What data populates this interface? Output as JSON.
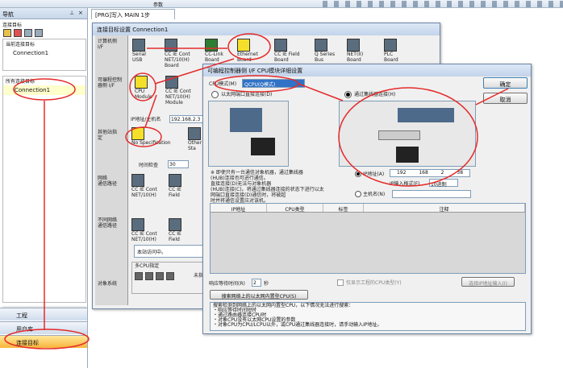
{
  "topbar": {
    "project_label": "参数"
  },
  "nav": {
    "title": "导航",
    "section_label": "连接目标",
    "current_label": "当前连接目标",
    "current_item": "Connection1",
    "all_label": "所有连接目标",
    "all_item": "Connection1",
    "buttons": [
      "工程",
      "用户库",
      "连接目标"
    ]
  },
  "tab": {
    "label": "[PRG]写入 MAIN 1步"
  },
  "conn": {
    "title": "连接目标设置 Connection1",
    "side": {
      "pc_if": "计算机侧\nI/F",
      "plc_if": "可编程控制\n器侧 I/F",
      "other_station": "其他站指\n定",
      "net_route": "网络\n通信路径",
      "diff_net": "不同网络\n通信路径",
      "target_system": "对象系统"
    },
    "pc_if_items": [
      "Serial\nUSB",
      "CC IE Cont\nNET/10(H)\nBoard",
      "CC-Link\nBoard",
      "Ethernet\nBoard",
      "CC IE Field\nBoard",
      "Q Series\nBus",
      "NET(II)\nBoard",
      "PLC\nBoard"
    ],
    "plc_if_items": [
      "CPU\nModule",
      "CC IE Cont\nNET/10(H)\nModule"
    ],
    "ip_label": "IP地址/主机名",
    "ip_value": "192.168.2.3",
    "other_items": [
      "No Specification",
      "Other\nSta"
    ],
    "timeout_label": "时间检查",
    "timeout_value": "30",
    "net_items": [
      "CC IE Cont\nNET/10(H)",
      "CC IE\nField"
    ],
    "diff_items": [
      "CC IE Cont\nNET/10(H)",
      "CC IE\nField"
    ],
    "diff_status": "未指定",
    "remark": "本站访问中。",
    "multi_cpu": "多CPU指定"
  },
  "detail": {
    "title": "可编程控制器侧 I/F CPU模块详细设置",
    "cpu_mode_label": "CPU模式(M)",
    "cpu_mode_value": "QCPU(Q模式)",
    "radio_direct": "以太网端口直接连接(D)",
    "radio_hub": "通过集线器连接(H)",
    "note": "※ 即使只有一台通信对象机器，通过集线器\n(HUB)连接也可进行通信。\n直接连接(D)无法与对象机器\n(HUB)连接(C)。将通过集线器连接的状态下进行以太\n网端口直接连接(D)通信时，将被超\n时并将通信设置应对该机。",
    "ip_label": "IP地址(A)",
    "ip_parts": [
      "192",
      "168",
      "2",
      "38"
    ],
    "ipfmt_label": "IP输入格式(F)",
    "ipfmt_value": "10进制",
    "host_label": "主机名(N)",
    "table_headers": [
      "IP地址",
      "CPU类型",
      "标签",
      "注释"
    ],
    "wait_label": "响应等待时间(R)",
    "wait_value": "2",
    "wait_unit": "秒",
    "only_type": "仅显示工程的CPU类型(Y)",
    "select_ip": "选择IP地址输入(I)",
    "search_btn": "搜索网络上的以太网内置型CPU(S)",
    "info": "搜索检测到网络上的以太网内置型CPU，以下情况无法进行搜索：\n・响应等待时间短时\n・通过路由器连接CPU时\n・对象CPU没有以太网CPU设置的参数\n・对象CPU为CPU/LCPU以外，或CPU通过集线器连接时，请手动输入IP地址。",
    "ok": "确定",
    "cancel": "取消"
  }
}
